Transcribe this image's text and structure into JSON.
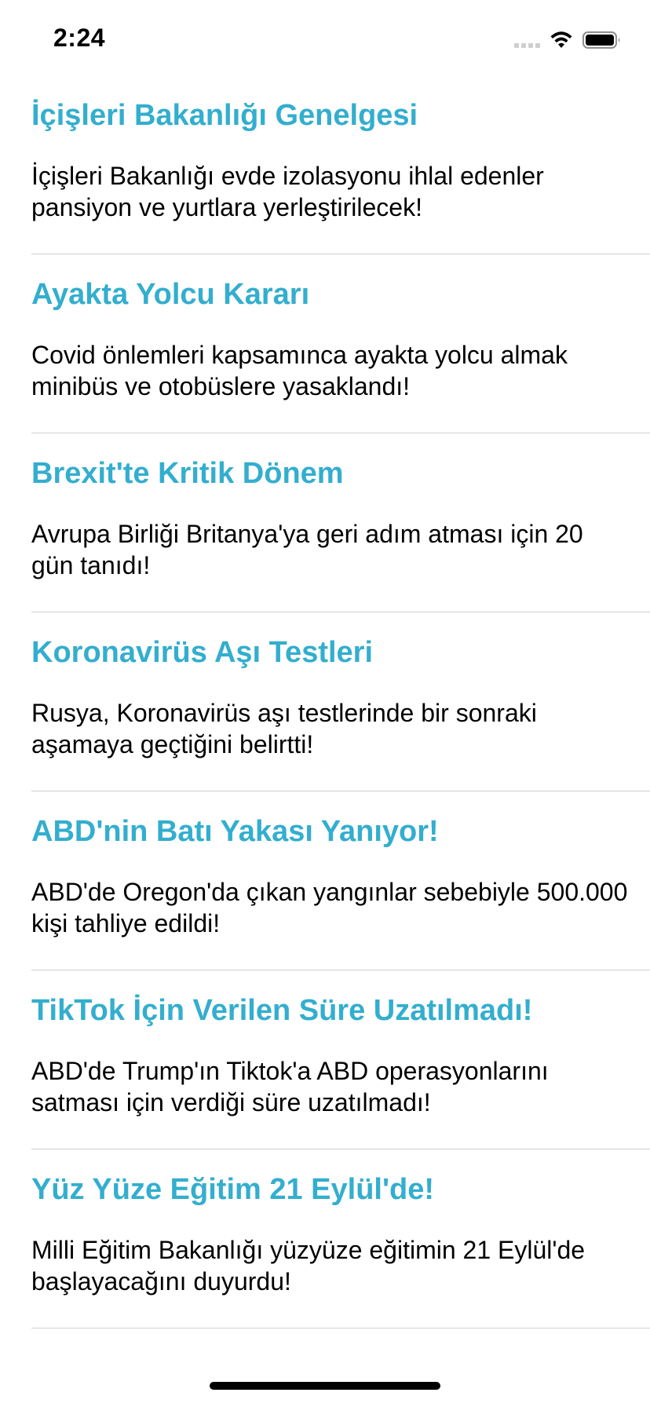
{
  "status_bar": {
    "time": "2:24"
  },
  "news": [
    {
      "title": "İçişleri Bakanlığı Genelgesi",
      "body": "İçişleri Bakanlığı evde izolasyonu ihlal edenler pansiyon ve yurtlara yerleştirilecek!"
    },
    {
      "title": "Ayakta Yolcu Kararı",
      "body": "Covid önlemleri kapsamınca ayakta yolcu almak minibüs ve otobüslere yasaklandı!"
    },
    {
      "title": "Brexit'te Kritik Dönem",
      "body": "Avrupa Birliği Britanya'ya geri adım atması için 20 gün tanıdı!"
    },
    {
      "title": "Koronavirüs Aşı Testleri",
      "body": "Rusya, Koronavirüs aşı testlerinde bir sonraki aşamaya geçtiğini belirtti!"
    },
    {
      "title": "ABD'nin Batı Yakası Yanıyor!",
      "body": "ABD'de Oregon'da çıkan yangınlar sebebiyle 500.000 kişi tahliye edildi!"
    },
    {
      "title": "TikTok İçin Verilen Süre Uzatılmadı!",
      "body": "ABD'de Trump'ın Tiktok'a ABD operasyonlarını satması için verdiği süre uzatılmadı!"
    },
    {
      "title": "Yüz Yüze Eğitim 21 Eylül'de!",
      "body": "Milli Eğitim Bakanlığı yüzyüze eğitimin 21 Eylül'de başlayacağını duyurdu!"
    }
  ],
  "colors": {
    "title": "#33aece",
    "separator": "#d0d0d5"
  },
  "icons": [
    "signal-icon",
    "wifi-icon",
    "battery-icon"
  ]
}
